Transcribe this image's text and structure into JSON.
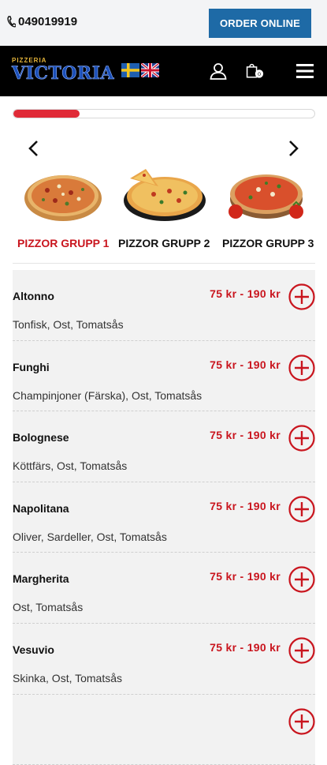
{
  "topbar": {
    "phone": "049019919",
    "order_button": "ORDER ONLINE"
  },
  "header": {
    "logo_small": "PIZZERIA",
    "logo_big": "VICTORIA",
    "cart_count": "0"
  },
  "progress": {
    "value": 0.22
  },
  "categories": [
    {
      "label": "PIZZOR GRUPP 1",
      "active": true
    },
    {
      "label": "PIZZOR GRUPP 2",
      "active": false
    },
    {
      "label": "PIZZOR GRUPP 3",
      "active": false
    }
  ],
  "items": [
    {
      "name": "Altonno",
      "price": "75 kr - 190 kr",
      "desc": "Tonfisk, Ost, Tomatsås"
    },
    {
      "name": "Funghi",
      "price": "75 kr - 190 kr",
      "desc": "Champinjoner (Färska), Ost, Tomatsås"
    },
    {
      "name": "Bolognese",
      "price": "75 kr - 190 kr",
      "desc": "Köttfärs, Ost, Tomatsås"
    },
    {
      "name": "Napolitana",
      "price": "75 kr - 190 kr",
      "desc": "Oliver, Sardeller, Ost, Tomatsås"
    },
    {
      "name": "Margherita",
      "price": "75 kr - 190 kr",
      "desc": "Ost, Tomatsås"
    },
    {
      "name": "Vesuvio",
      "price": "75 kr - 190 kr",
      "desc": "Skinka, Ost, Tomatsås"
    }
  ],
  "colors": {
    "accent": "#c9151e",
    "button_blue": "#1e6aa6",
    "header_bg": "#000000"
  }
}
